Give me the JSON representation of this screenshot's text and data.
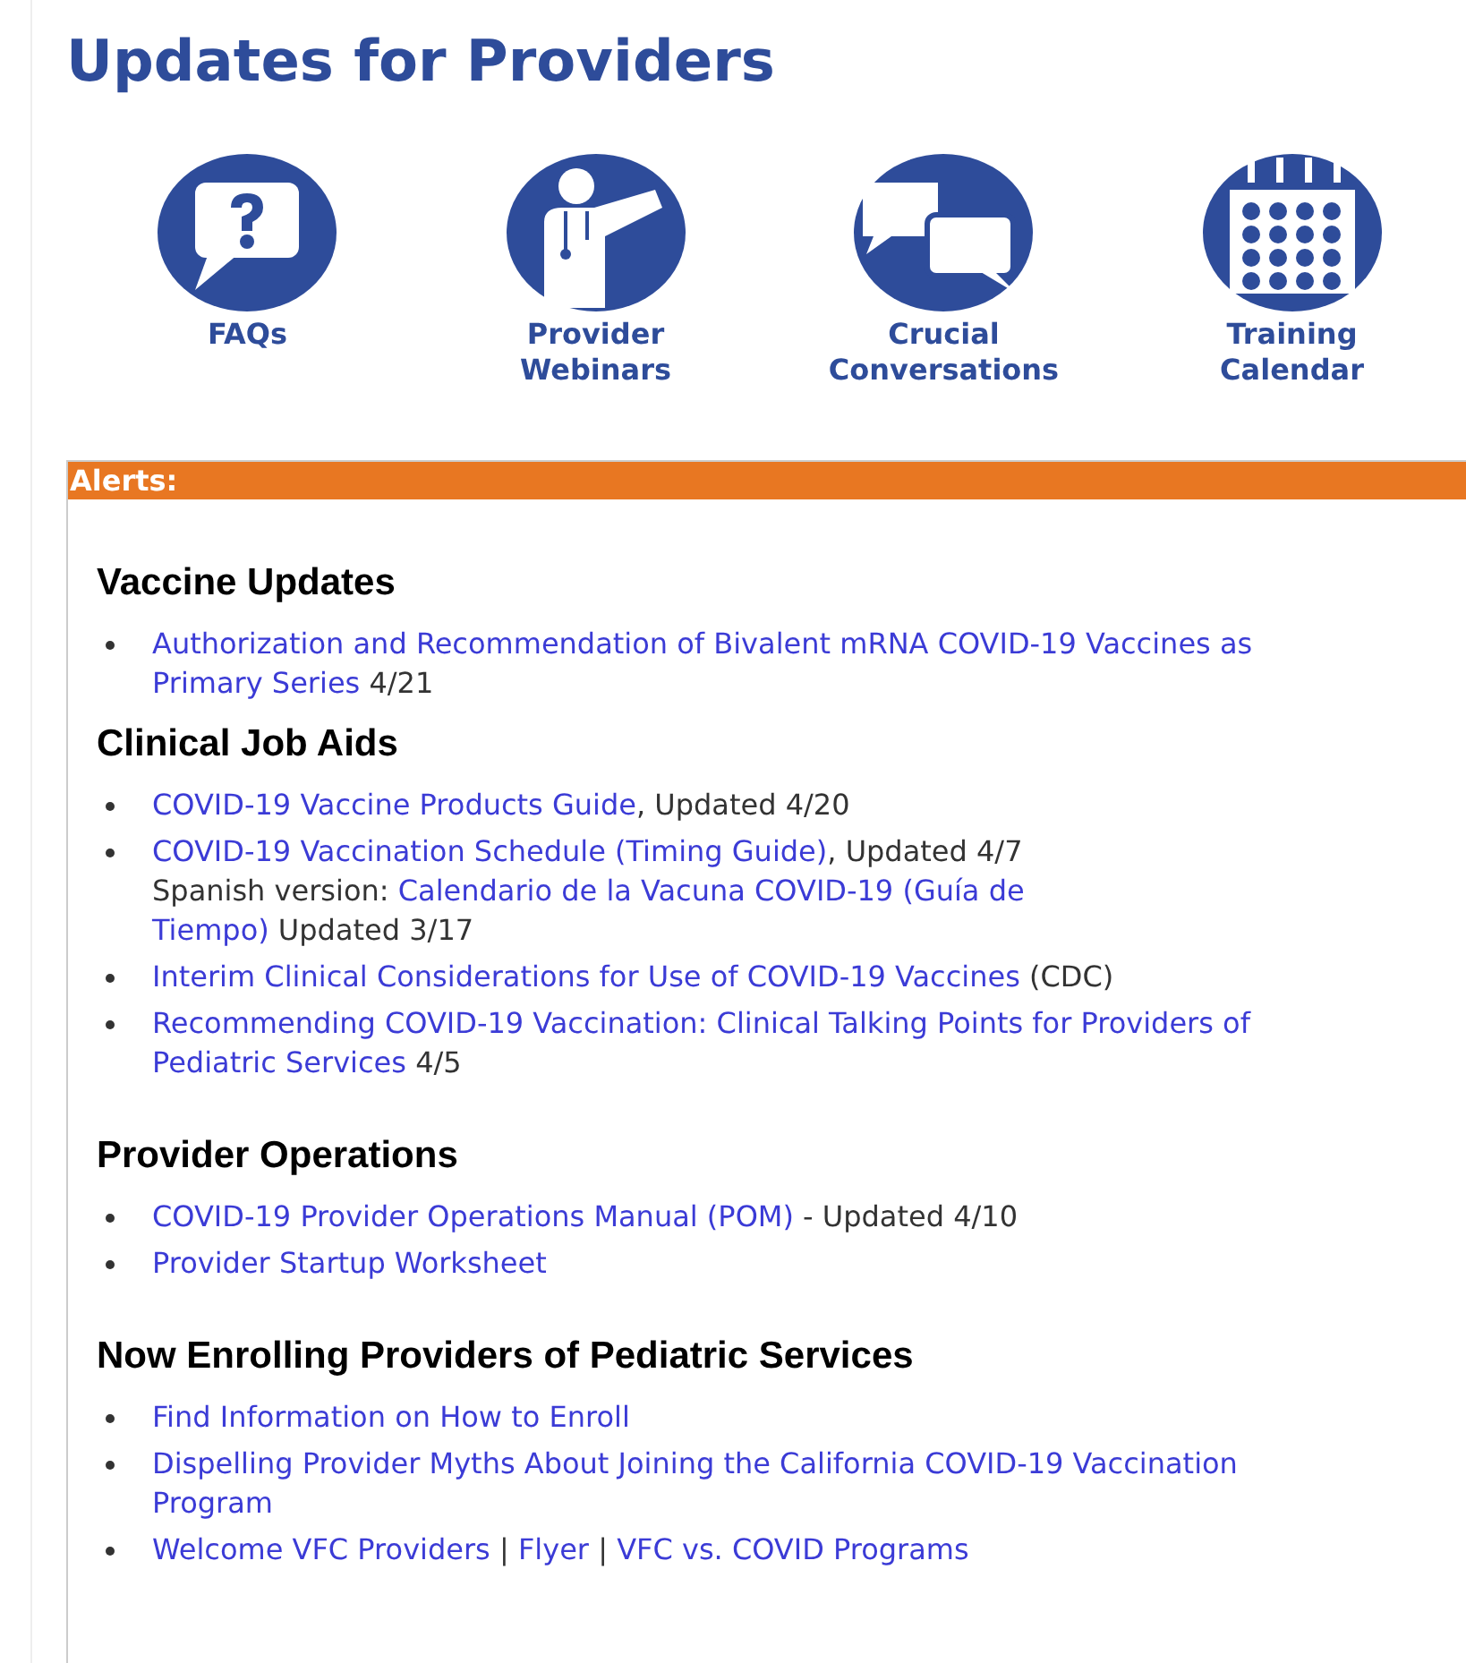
{
  "title": "Updates for Providers",
  "shortcuts": [
    {
      "kind": "faq",
      "label_lines": [
        "FAQs"
      ]
    },
    {
      "kind": "webinar",
      "label_lines": [
        "Provider",
        "Webinars"
      ]
    },
    {
      "kind": "conversation",
      "label_lines": [
        "Crucial",
        "Conversations"
      ]
    },
    {
      "kind": "calendar",
      "label_lines": [
        "Training",
        "Calendar"
      ]
    }
  ],
  "alerts": {
    "heading": "Alerts:",
    "sections": [
      {
        "heading": "Vaccine Updates",
        "items": [
          {
            "lines": [
              [
                {
                  "kind": "link",
                  "text": "Authorization and Recommendation of Bivalent mRNA COVID-19 Vaccines as"
                }
              ],
              [
                {
                  "kind": "link",
                  "text": "Primary Series"
                },
                {
                  "kind": "text",
                  "text": " 4/21"
                }
              ]
            ]
          }
        ]
      },
      {
        "heading": "Clinical Job Aids",
        "items": [
          {
            "lines": [
              [
                {
                  "kind": "link",
                  "text": "COVID-19 Vaccine Products Guide"
                },
                {
                  "kind": "text",
                  "text": ", Updated 4/20"
                }
              ]
            ]
          },
          {
            "lines": [
              [
                {
                  "kind": "link",
                  "text": "COVID-19 Vaccination Schedule (Timing Guide)"
                },
                {
                  "kind": "text",
                  "text": ", Updated 4/7"
                }
              ],
              [
                {
                  "kind": "text",
                  "text": "Spanish version: "
                },
                {
                  "kind": "link",
                  "text": "Calendario de la Vacuna COVID-19 (Guía de"
                }
              ],
              [
                {
                  "kind": "link",
                  "text": "Tiempo)"
                },
                {
                  "kind": "text",
                  "text": " Updated 3/17"
                }
              ]
            ]
          },
          {
            "lines": [
              [
                {
                  "kind": "link",
                  "text": "Interim Clinical Considerations for Use of COVID-19 Vaccines"
                },
                {
                  "kind": "text",
                  "text": " (CDC)"
                }
              ]
            ]
          },
          {
            "lines": [
              [
                {
                  "kind": "link",
                  "text": "Recommending COVID-19 Vaccination: Clinical Talking Points for Providers of"
                }
              ],
              [
                {
                  "kind": "link",
                  "text": "Pediatric Services"
                },
                {
                  "kind": "text",
                  "text": " 4/5"
                }
              ]
            ]
          }
        ]
      },
      {
        "heading": "Provider Operations",
        "items": [
          {
            "lines": [
              [
                {
                  "kind": "link",
                  "text": "COVID-19 Provider Operations Manual (POM)"
                },
                {
                  "kind": "text",
                  "text": " - Updated 4/10"
                }
              ]
            ]
          },
          {
            "lines": [
              [
                {
                  "kind": "link",
                  "text": "Provider Startup Worksheet"
                }
              ]
            ]
          }
        ]
      },
      {
        "heading": "Now Enrolling Providers of Pediatric Services",
        "items": [
          {
            "lines": [
              [
                {
                  "kind": "link",
                  "text": "Find Information on How to Enroll"
                }
              ]
            ]
          },
          {
            "lines": [
              [
                {
                  "kind": "link",
                  "text": "Dispelling Provider Myths About Joining the California COVID-19 Vaccination"
                }
              ],
              [
                {
                  "kind": "link",
                  "text": "Program"
                }
              ]
            ]
          },
          {
            "lines": [
              [
                {
                  "kind": "link",
                  "text": "Welcome VFC Providers"
                },
                {
                  "kind": "text",
                  "text": " | "
                },
                {
                  "kind": "link",
                  "text": "Flyer"
                },
                {
                  "kind": "text",
                  "text": " | "
                },
                {
                  "kind": "link",
                  "text": "VFC vs. COVID Programs"
                }
              ]
            ]
          }
        ]
      }
    ]
  }
}
